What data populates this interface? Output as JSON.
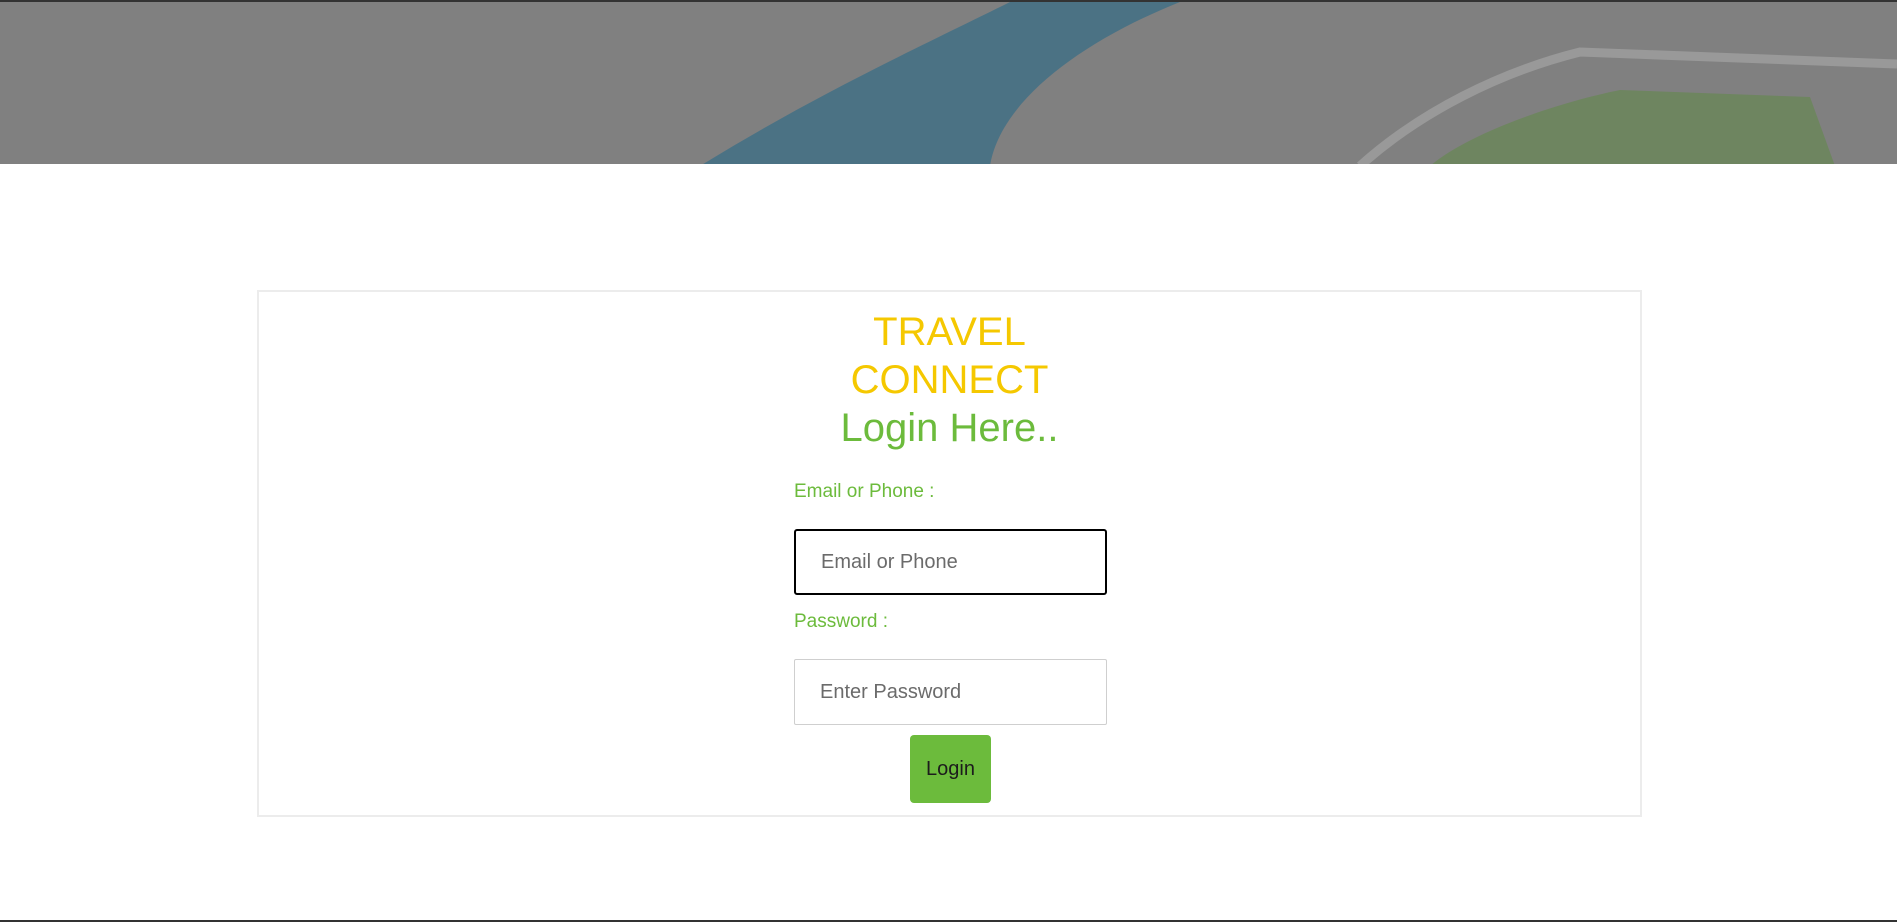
{
  "brand": {
    "line1": "TRAVEL",
    "line2": "CONNECT"
  },
  "login": {
    "title": "Login Here..",
    "email_label": "Email or Phone :",
    "email_placeholder": "Email or Phone",
    "email_value": "",
    "password_label": "Password :",
    "password_placeholder": "Enter Password",
    "password_value": "",
    "submit_label": "Login"
  },
  "colors": {
    "brand": "#f5c800",
    "accent": "#6cbb3c",
    "hero_overlay": "#808080"
  }
}
